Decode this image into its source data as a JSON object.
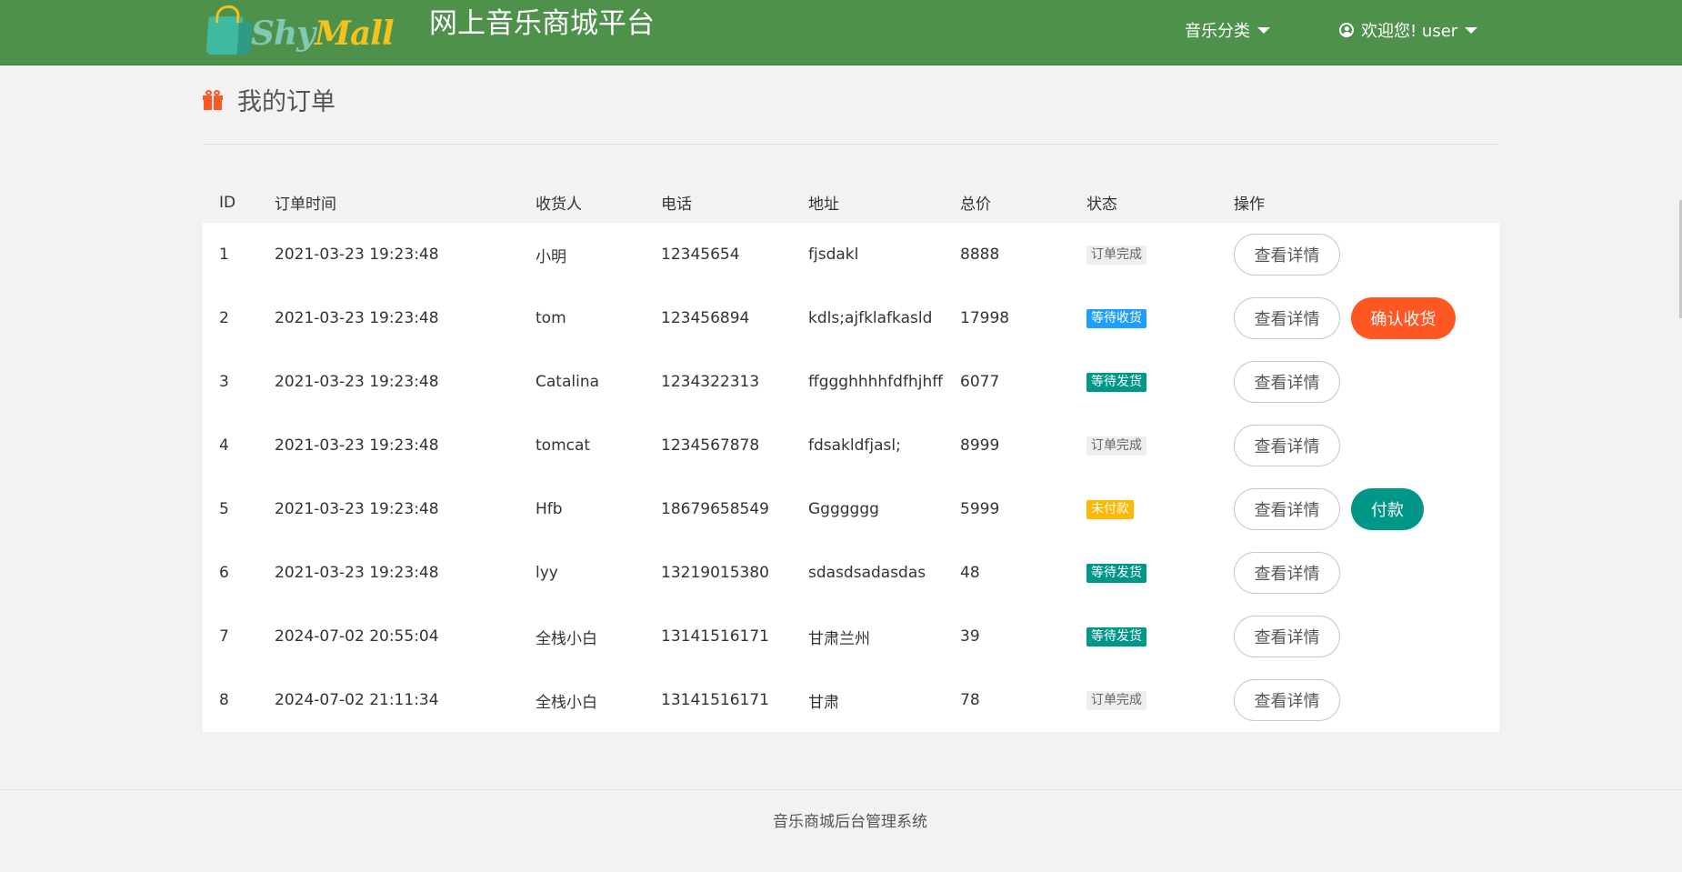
{
  "header": {
    "logo_text_1": "Shy",
    "logo_text_2": "Mall",
    "site_title": "网上音乐商城平台",
    "nav_category": "音乐分类",
    "nav_user": "欢迎您! user"
  },
  "page": {
    "title": "我的订单"
  },
  "table": {
    "columns": [
      "ID",
      "订单时间",
      "收货人",
      "电话",
      "地址",
      "总价",
      "状态",
      "操作"
    ],
    "rows": [
      {
        "id": "1",
        "time": "2021-03-23 19:23:48",
        "name": "小明",
        "phone": "12345654",
        "address": "fjsdakl",
        "total": "8888",
        "status": "订单完成",
        "status_color": "#eeeeee",
        "detail": "查看详情",
        "extra": ""
      },
      {
        "id": "2",
        "time": "2021-03-23 19:23:48",
        "name": "tom",
        "phone": "123456894",
        "address": "kdls;ajfklafkasld",
        "total": "17998",
        "status": "等待收货",
        "status_color": "#1e9fff",
        "detail": "查看详情",
        "extra": "确认收货"
      },
      {
        "id": "3",
        "time": "2021-03-23 19:23:48",
        "name": "Catalina",
        "phone": "1234322313",
        "address": "ffggghhhhfdfhjhff",
        "total": "6077",
        "status": "等待发货",
        "status_color": "#009688",
        "detail": "查看详情",
        "extra": ""
      },
      {
        "id": "4",
        "time": "2021-03-23 19:23:48",
        "name": "tomcat",
        "phone": "1234567878",
        "address": "fdsakldfjasl;",
        "total": "8999",
        "status": "订单完成",
        "status_color": "#eeeeee",
        "detail": "查看详情",
        "extra": ""
      },
      {
        "id": "5",
        "time": "2021-03-23 19:23:48",
        "name": "Hfb",
        "phone": "18679658549",
        "address": "Ggggggg",
        "total": "5999",
        "status": "未付款",
        "status_color": "#ffb800",
        "detail": "查看详情",
        "extra": "付款"
      },
      {
        "id": "6",
        "time": "2021-03-23 19:23:48",
        "name": "lyy",
        "phone": "13219015380",
        "address": "sdasdsadasdas",
        "total": "48",
        "status": "等待发货",
        "status_color": "#009688",
        "detail": "查看详情",
        "extra": ""
      },
      {
        "id": "7",
        "time": "2024-07-02 20:55:04",
        "name": "全栈小白",
        "phone": "13141516171",
        "address": "甘肃兰州",
        "total": "39",
        "status": "等待发货",
        "status_color": "#009688",
        "detail": "查看详情",
        "extra": ""
      },
      {
        "id": "8",
        "time": "2024-07-02 21:11:34",
        "name": "全栈小白",
        "phone": "13141516171",
        "address": "甘肃",
        "total": "78",
        "status": "订单完成",
        "status_color": "#eeeeee",
        "detail": "查看详情",
        "extra": ""
      }
    ]
  },
  "footer": {
    "text": "音乐商城后台管理系统"
  },
  "colors": {
    "header_bg": "#4d914b",
    "accent_orange": "#ff5722",
    "accent_teal": "#009688",
    "accent_blue": "#1e9fff",
    "accent_yellow": "#ffb800"
  }
}
